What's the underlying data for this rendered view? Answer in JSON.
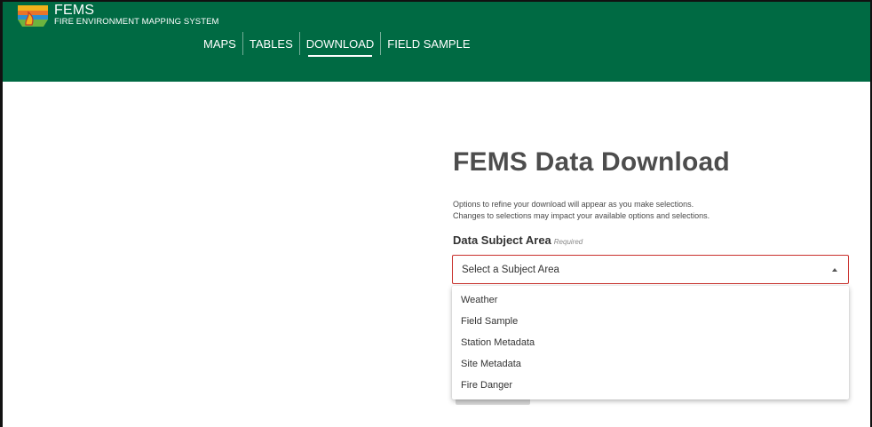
{
  "colors": {
    "header_green": "#006a43",
    "select_border": "#c9302c"
  },
  "brand": {
    "logo_icon": "fems-logo",
    "title": "FEMS",
    "subtitle": "FIRE ENVIRONMENT MAPPING SYSTEM"
  },
  "nav": {
    "items": [
      {
        "label": "MAPS"
      },
      {
        "label": "TABLES"
      },
      {
        "label": "DOWNLOAD",
        "active": true
      },
      {
        "label": "FIELD SAMPLE"
      }
    ]
  },
  "main": {
    "title": "FEMS Data Download",
    "help_line1": "Options to refine your download will appear as you make selections.",
    "help_line2": "Changes to selections may impact your available options and selections.",
    "field_label": "Data Subject Area",
    "field_required": "Required",
    "select_placeholder": "Select a Subject Area",
    "select_icon": "caret-up-icon",
    "options": [
      {
        "label": "Weather"
      },
      {
        "label": "Field Sample"
      },
      {
        "label": "Station Metadata"
      },
      {
        "label": "Site Metadata"
      },
      {
        "label": "Fire Danger"
      }
    ]
  }
}
